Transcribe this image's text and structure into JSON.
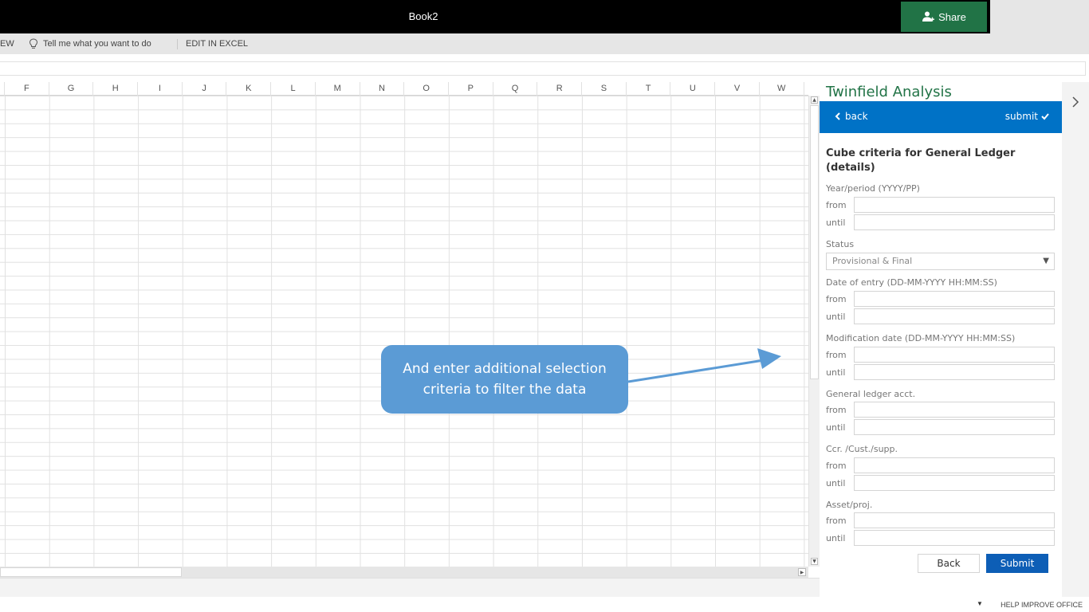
{
  "titlebar": {
    "doc_title": "Book2",
    "share_label": "Share",
    "share_color": "#217346"
  },
  "ribbon": {
    "tab_fragment": "EW",
    "tell_me": "Tell me what you want to do",
    "edit_in_excel": "EDIT IN EXCEL"
  },
  "grid": {
    "columns": [
      "F",
      "G",
      "H",
      "I",
      "J",
      "K",
      "L",
      "M",
      "N",
      "O",
      "P",
      "Q",
      "R",
      "S",
      "T",
      "U",
      "V",
      "W"
    ]
  },
  "callout": {
    "text": "And enter additional selection criteria to filter the data",
    "color": "#5b9bd5"
  },
  "pane": {
    "title": "Twinfield Analysis",
    "nav_back": "back",
    "nav_submit": "submit",
    "heading": "Cube criteria for General Ledger (details)",
    "from_label": "from",
    "until_label": "until",
    "fields": {
      "year_period": "Year/period (YYYY/PP)",
      "status": "Status",
      "status_value": "Provisional & Final",
      "date_of_entry": "Date of entry (DD-MM-YYYY HH:MM:SS)",
      "modification_date": "Modification date (DD-MM-YYYY HH:MM:SS)",
      "gl_account": "General ledger acct.",
      "ccr_cust_supp": "Ccr. /Cust./supp.",
      "asset_proj": "Asset/proj."
    },
    "back_button": "Back",
    "submit_button": "Submit",
    "accent_color": "#0072c6"
  },
  "status_bar": {
    "help": "HELP IMPROVE OFFICE"
  }
}
